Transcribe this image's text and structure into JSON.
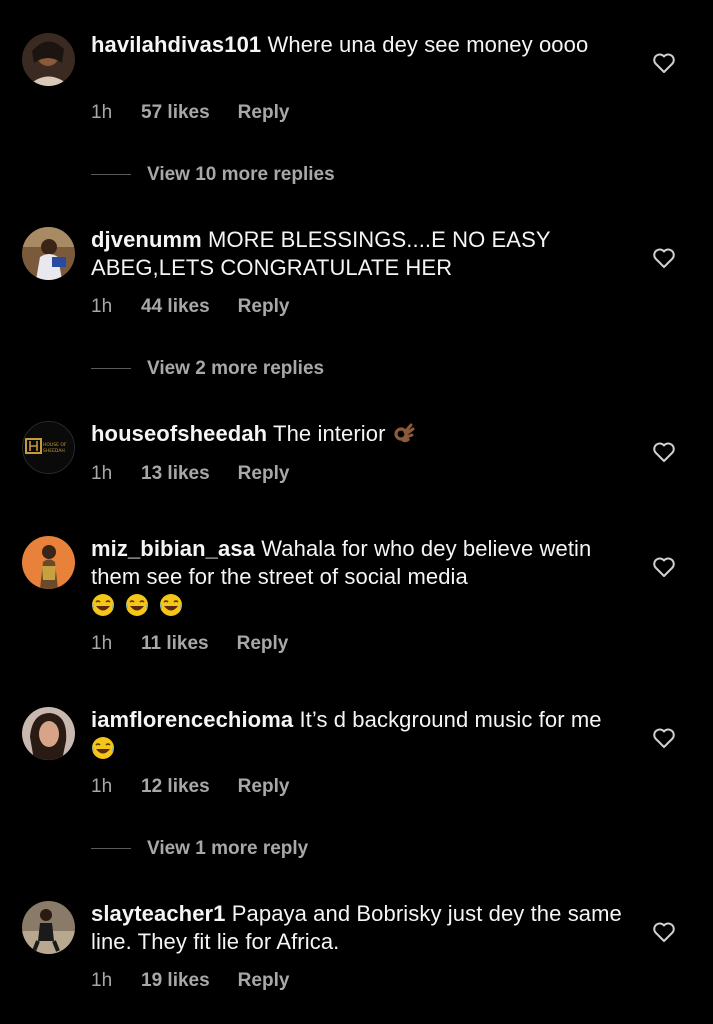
{
  "comments": [
    {
      "username": "havilahdivas101",
      "text": "Where una dey see money oooo",
      "time": "1h",
      "likes": "57 likes",
      "reply": "Reply",
      "view_replies": "View 10 more replies"
    },
    {
      "username": "djvenumm",
      "text": "MORE BLESSINGS....E NO EASY ABEG,LETS CONGRATULATE HER",
      "time": "1h",
      "likes": "44 likes",
      "reply": "Reply",
      "view_replies": "View 2 more replies"
    },
    {
      "username": "houseofsheedah",
      "text": "The interior",
      "emoji": [
        "ok-hand-emoji"
      ],
      "time": "1h",
      "likes": "13 likes",
      "reply": "Reply",
      "avatar_label": "HOUSE OF SHEEDAH"
    },
    {
      "username": "miz_bibian_asa",
      "text": "Wahala for who dey believe wetin them see for the street of social media",
      "emoji": [
        "tears-of-joy-emoji",
        "tears-of-joy-emoji",
        "tears-of-joy-emoji"
      ],
      "time": "1h",
      "likes": "11 likes",
      "reply": "Reply"
    },
    {
      "username": "iamflorencechioma",
      "text": "It’s d background music for me",
      "emoji": [
        "tears-of-joy-emoji"
      ],
      "time": "1h",
      "likes": "12 likes",
      "reply": "Reply",
      "view_replies": "View 1 more reply"
    },
    {
      "username": "slayteacher1",
      "text": "Papaya and Bobrisky just dey the same line. They fit lie for Africa.",
      "time": "1h",
      "likes": "19 likes",
      "reply": "Reply"
    }
  ],
  "colors": {
    "background": "#000000",
    "text": "#f5f5f5",
    "secondary": "#a8a8a8",
    "brand_gold": "#c79a3b"
  },
  "icons": [
    "heart-outline-icon"
  ]
}
